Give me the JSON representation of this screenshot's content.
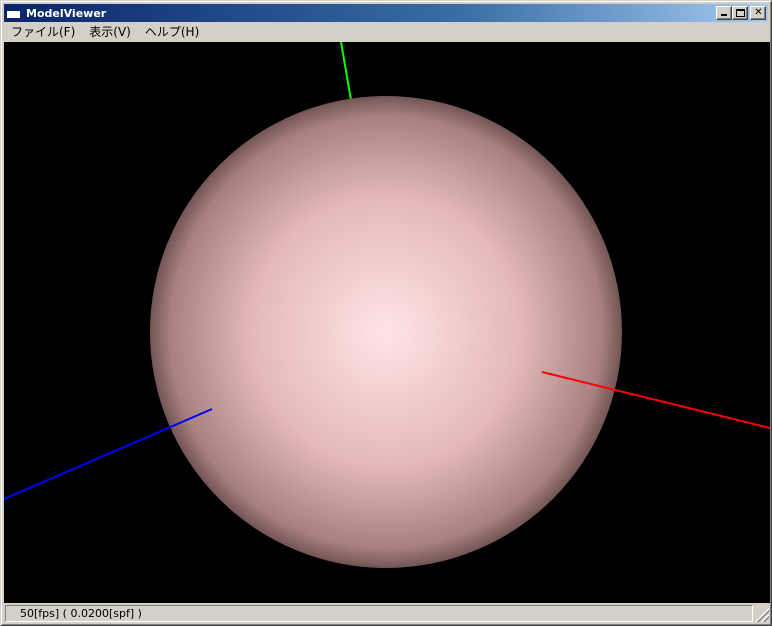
{
  "window": {
    "title": "ModelViewer"
  },
  "menu": {
    "items": [
      {
        "label": "ファイル(F)"
      },
      {
        "label": "表示(V)"
      },
      {
        "label": "ヘルプ(H)"
      }
    ]
  },
  "caption_buttons": {
    "close_glyph": "✕"
  },
  "scene": {
    "background": "#000000",
    "sphere_color_light": "#ffe4e4",
    "sphere_color_mid": "#e4b8b8",
    "sphere_color_dark": "#5a4040",
    "axis_x_color": "#ff0000",
    "axis_y_color": "#00ff00",
    "axis_z_color": "#0000ff"
  },
  "status": {
    "text": "50[fps] ( 0.0200[spf] )"
  },
  "icons": {
    "app": "window-icon",
    "minimize": "minimize-icon",
    "maximize": "maximize-icon",
    "close": "close-icon",
    "grip": "resize-grip-icon"
  }
}
